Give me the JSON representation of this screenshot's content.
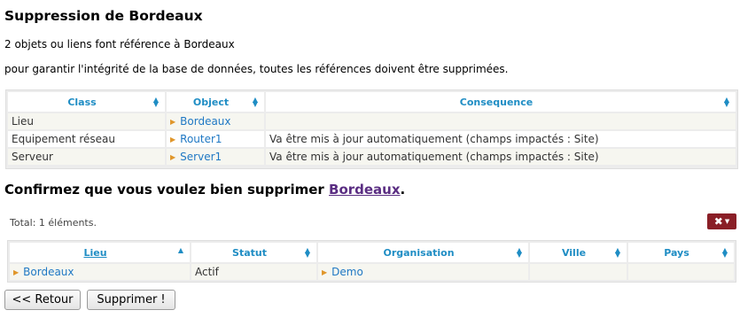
{
  "title": "Suppression de Bordeaux",
  "info_line1": "2 objets ou liens font référence à Bordeaux",
  "info_line2": "pour garantir l'intégrité de la base de données, toutes les références doivent être supprimées.",
  "references_table": {
    "columns": [
      "Class",
      "Object",
      "Consequence"
    ],
    "rows": [
      {
        "class": "Lieu",
        "object": "Bordeaux",
        "consequence": ""
      },
      {
        "class": "Equipement réseau",
        "object": "Router1",
        "consequence": "Va être mis à jour automatiquement (champs impactés : Site)"
      },
      {
        "class": "Serveur",
        "object": "Server1",
        "consequence": "Va être mis à jour automatiquement (champs impactés : Site)"
      }
    ]
  },
  "confirm": {
    "prefix": "Confirmez que vous voulez bien supprimer ",
    "link": "Bordeaux",
    "suffix": "."
  },
  "list": {
    "total": "Total: 1 éléments.",
    "columns": [
      "Lieu",
      "Statut",
      "Organisation",
      "Ville",
      "Pays"
    ],
    "rows": [
      {
        "lieu": "Bordeaux",
        "statut": "Actif",
        "organisation": "Demo",
        "ville": "",
        "pays": ""
      }
    ]
  },
  "buttons": {
    "back": "<< Retour",
    "delete": "Supprimer !"
  },
  "icons": {
    "tools": "tools-icon",
    "sort": "sort-icon",
    "bullet": "bullet-triangle-icon"
  },
  "colors": {
    "header_text": "#1f8dc4",
    "link": "#1f78c4",
    "tools_button": "#8a1f27",
    "confirm_link": "#5a2d82",
    "bullet": "#e0962a"
  }
}
